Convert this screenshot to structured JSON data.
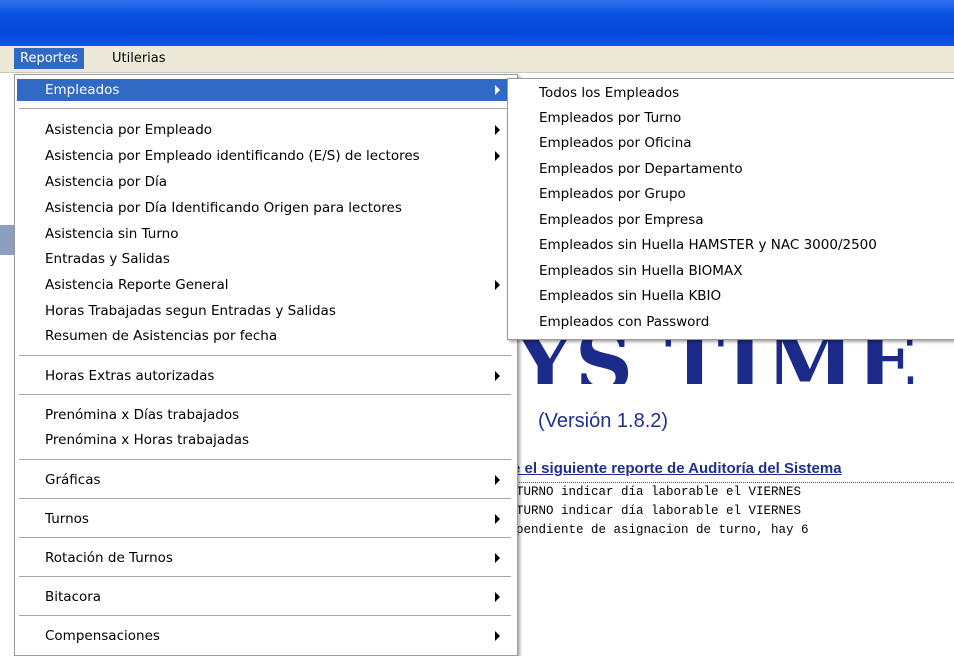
{
  "menubar": {
    "reportes": "Reportes",
    "utilerias": "Utilerias"
  },
  "background": {
    "title_fragment": "YS TIME",
    "version": "(Versión 1.8.2)",
    "report_heading": "e el siguiente reporte de Auditoría del Sistema",
    "log_lines": [
      "TURNO indicar día laborable el VIERNES",
      "TURNO indicar día laborable el VIERNES",
      "pendiente de asignacion de turno, hay 6"
    ]
  },
  "main_menu": {
    "empleados": "Empleados",
    "asistencia_por_empleado": "Asistencia por Empleado",
    "asistencia_por_empleado_es": "Asistencia por Empleado identificando (E/S) de lectores",
    "asistencia_por_dia": "Asistencia por Día",
    "asistencia_por_dia_origen": "Asistencia por Día Identificando Origen para lectores",
    "asistencia_sin_turno": "Asistencia sin Turno",
    "entradas_y_salidas": "Entradas y Salidas",
    "asistencia_reporte_general": "Asistencia Reporte General",
    "horas_trabajadas": "Horas Trabajadas segun Entradas y Salidas",
    "resumen_asistencias": "Resumen de Asistencias por fecha",
    "horas_extras": "Horas Extras autorizadas",
    "prenomina_dias": "Prenómina x Días trabajados",
    "prenomina_horas": "Prenómina x Horas trabajadas",
    "graficas": "Gráficas",
    "turnos": "Turnos",
    "rotacion_turnos": "Rotación de Turnos",
    "bitacora": "Bitacora",
    "compensaciones": "Compensaciones"
  },
  "submenu": {
    "items": [
      "Todos los Empleados",
      "Empleados por Turno",
      "Empleados por Oficina",
      "Empleados por Departamento",
      "Empleados por Grupo",
      "Empleados por Empresa",
      "Empleados sin Huella HAMSTER y NAC 3000/2500",
      "Empleados sin Huella BIOMAX",
      "Empleados sin Huella KBIO",
      "Empleados con Password"
    ]
  },
  "colors": {
    "title_bar": "#0a53e3",
    "menu_highlight": "#316ac5",
    "menubar_bg": "#ece9d8",
    "app_title_blue": "#1c2a8a"
  }
}
